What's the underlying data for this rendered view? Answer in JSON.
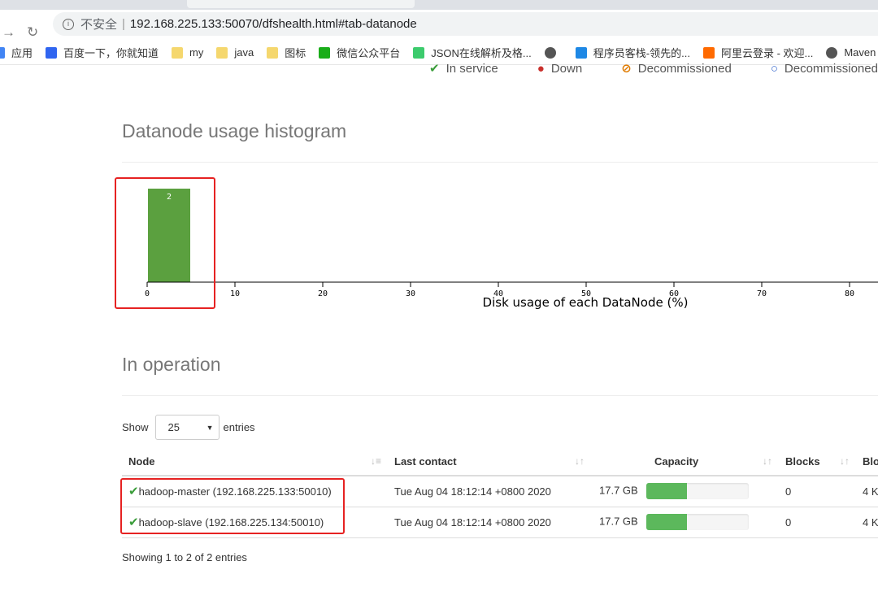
{
  "browser": {
    "insecure_label": "不安全",
    "url": "192.168.225.133:50070/dfshealth.html#tab-datanode",
    "bookmarks": [
      {
        "label": "应用",
        "color": "#4285f4"
      },
      {
        "label": "百度一下，你就知道",
        "color": "#3065f0"
      },
      {
        "label": "my",
        "color": "#f5d76e"
      },
      {
        "label": "java",
        "color": "#f5d76e"
      },
      {
        "label": "图标",
        "color": "#f5d76e"
      },
      {
        "label": "微信公众平台",
        "color": "#1aad19"
      },
      {
        "label": "JSON在线解析及格...",
        "color": "#3ccb6d"
      },
      {
        "label": "",
        "color": "#555"
      },
      {
        "label": "程序员客栈-领先的...",
        "color": "#1e88e5"
      },
      {
        "label": "阿里云登录 - 欢迎...",
        "color": "#ff6a00"
      },
      {
        "label": "Maven",
        "color": "#555"
      }
    ]
  },
  "legend": [
    "In service",
    "Down",
    "Decommissioned",
    "Decommissioned & dead"
  ],
  "histogram": {
    "heading": "Datanode usage histogram"
  },
  "chart_data": {
    "type": "bar",
    "xlabel": "Disk usage of each DataNode (%)",
    "xlim": [
      0,
      90
    ],
    "ticks": [
      0,
      10,
      20,
      30,
      40,
      50,
      60,
      70,
      80
    ],
    "bins": [
      {
        "x0": 0,
        "x1": 5,
        "count": 2
      }
    ],
    "bar_color": "#5ba03f"
  },
  "operation": {
    "heading": "In operation",
    "show_label": "Show",
    "entries_label": "entries",
    "page_size": "25",
    "columns": [
      "Node",
      "Last contact",
      "Capacity",
      "Blocks",
      "Blo"
    ],
    "rows": [
      {
        "node": "hadoop-master (192.168.225.133:50010)",
        "last_contact": "Tue Aug 04 18:12:14 +0800 2020",
        "capacity": "17.7 GB",
        "capacity_used_pct": 40,
        "blocks": "0",
        "block_pool": "4 K"
      },
      {
        "node": "hadoop-slave (192.168.225.134:50010)",
        "last_contact": "Tue Aug 04 18:12:14 +0800 2020",
        "capacity": "17.7 GB",
        "capacity_used_pct": 40,
        "blocks": "0",
        "block_pool": "4 K"
      }
    ],
    "info": "Showing 1 to 2 of 2 entries"
  },
  "colors": {
    "accent": "#5cb85c",
    "highlight": "#e62222"
  }
}
